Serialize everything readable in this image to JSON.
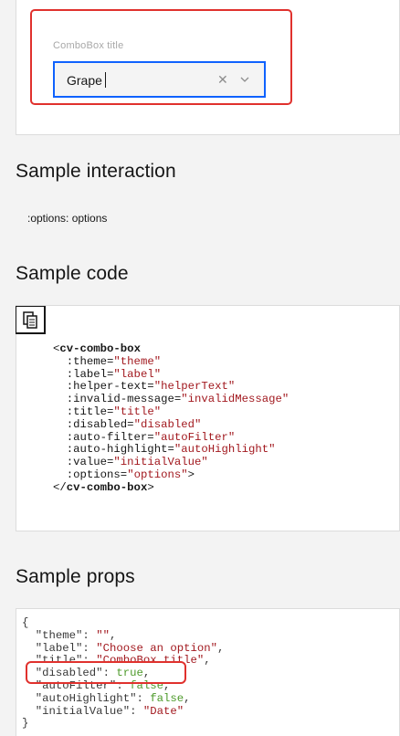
{
  "combobox": {
    "title": "ComboBox title",
    "value": "Grape"
  },
  "sections": {
    "interaction": "Sample interaction",
    "code": "Sample code",
    "props": "Sample props"
  },
  "interaction_text": ":options: options",
  "code_lines": [
    {
      "parts": [
        {
          "t": "<",
          "c": "plain"
        },
        {
          "t": "cv-combo-box",
          "c": "tag"
        }
      ]
    },
    {
      "parts": [
        {
          "t": "  :theme=",
          "c": "plain"
        },
        {
          "t": "\"theme\"",
          "c": "str"
        }
      ]
    },
    {
      "parts": [
        {
          "t": "  :label=",
          "c": "plain"
        },
        {
          "t": "\"label\"",
          "c": "str"
        }
      ]
    },
    {
      "parts": [
        {
          "t": "  :helper-text=",
          "c": "plain"
        },
        {
          "t": "\"helperText\"",
          "c": "str"
        }
      ]
    },
    {
      "parts": [
        {
          "t": "  :invalid-message=",
          "c": "plain"
        },
        {
          "t": "\"invalidMessage\"",
          "c": "str"
        }
      ]
    },
    {
      "parts": [
        {
          "t": "  :title=",
          "c": "plain"
        },
        {
          "t": "\"title\"",
          "c": "str"
        }
      ]
    },
    {
      "parts": [
        {
          "t": "  :disabled=",
          "c": "plain"
        },
        {
          "t": "\"disabled\"",
          "c": "str"
        }
      ]
    },
    {
      "parts": [
        {
          "t": "  :auto-filter=",
          "c": "plain"
        },
        {
          "t": "\"autoFilter\"",
          "c": "str"
        }
      ]
    },
    {
      "parts": [
        {
          "t": "  :auto-highlight=",
          "c": "plain"
        },
        {
          "t": "\"autoHighlight\"",
          "c": "str"
        }
      ]
    },
    {
      "parts": [
        {
          "t": "  :value=",
          "c": "plain"
        },
        {
          "t": "\"initialValue\"",
          "c": "str"
        }
      ]
    },
    {
      "parts": [
        {
          "t": "  :options=",
          "c": "plain"
        },
        {
          "t": "\"options\"",
          "c": "str"
        },
        {
          "t": ">",
          "c": "plain"
        }
      ]
    },
    {
      "parts": [
        {
          "t": "</",
          "c": "plain"
        },
        {
          "t": "cv-combo-box",
          "c": "tag"
        },
        {
          "t": ">",
          "c": "plain"
        }
      ]
    }
  ],
  "props_lines": [
    {
      "parts": [
        {
          "t": "{",
          "c": "plain"
        }
      ]
    },
    {
      "parts": [
        {
          "t": "  \"theme\"",
          "c": "key"
        },
        {
          "t": ": ",
          "c": "plain"
        },
        {
          "t": "\"\"",
          "c": "str"
        },
        {
          "t": ",",
          "c": "plain"
        }
      ]
    },
    {
      "parts": [
        {
          "t": "  \"label\"",
          "c": "key"
        },
        {
          "t": ": ",
          "c": "plain"
        },
        {
          "t": "\"Choose an option\"",
          "c": "str"
        },
        {
          "t": ",",
          "c": "plain"
        }
      ]
    },
    {
      "parts": [
        {
          "t": "  \"title\"",
          "c": "key"
        },
        {
          "t": ": ",
          "c": "plain"
        },
        {
          "t": "\"ComboBox title\"",
          "c": "str"
        },
        {
          "t": ",",
          "c": "plain"
        }
      ]
    },
    {
      "parts": [
        {
          "t": "  \"disabled\"",
          "c": "key"
        },
        {
          "t": ": ",
          "c": "plain"
        },
        {
          "t": "true",
          "c": "kw"
        },
        {
          "t": ",",
          "c": "plain"
        }
      ]
    },
    {
      "parts": [
        {
          "t": "  \"autoFilter\"",
          "c": "key"
        },
        {
          "t": ": ",
          "c": "plain"
        },
        {
          "t": "false",
          "c": "kw"
        },
        {
          "t": ",",
          "c": "plain"
        }
      ]
    },
    {
      "parts": [
        {
          "t": "  \"autoHighlight\"",
          "c": "key"
        },
        {
          "t": ": ",
          "c": "plain"
        },
        {
          "t": "false",
          "c": "kw"
        },
        {
          "t": ",",
          "c": "plain"
        }
      ]
    },
    {
      "parts": [
        {
          "t": "  \"initialValue\"",
          "c": "key"
        },
        {
          "t": ": ",
          "c": "plain"
        },
        {
          "t": "\"Date\"",
          "c": "str"
        }
      ]
    },
    {
      "parts": [
        {
          "t": "}",
          "c": "plain"
        }
      ]
    }
  ],
  "colors": {
    "highlight": "#e0312d",
    "focus": "#0f62fe",
    "string": "#a2191f",
    "boolean": "#4d9a2a"
  },
  "icons": {
    "clear": "close-icon",
    "open": "chevron-down-icon",
    "copy": "copy-icon"
  }
}
